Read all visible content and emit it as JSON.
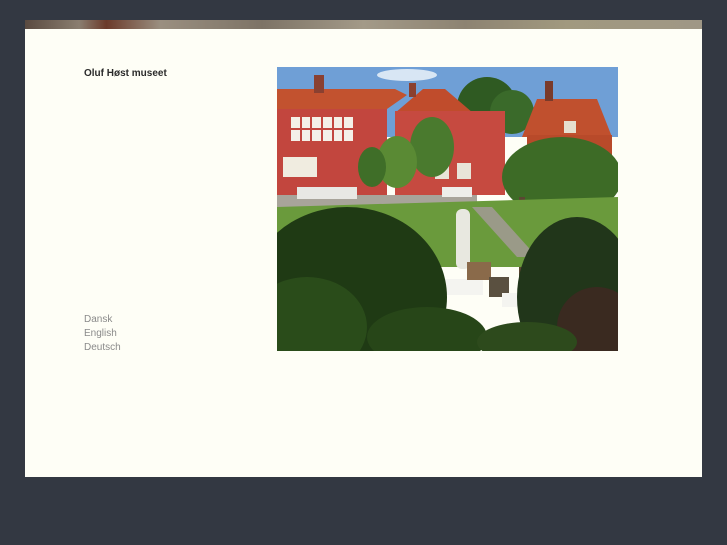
{
  "header": {
    "title": "Oluf Høst museet"
  },
  "languages": [
    "Dansk",
    "English",
    "Deutsch"
  ],
  "photo": {
    "subject": "museum-garden-photo"
  }
}
